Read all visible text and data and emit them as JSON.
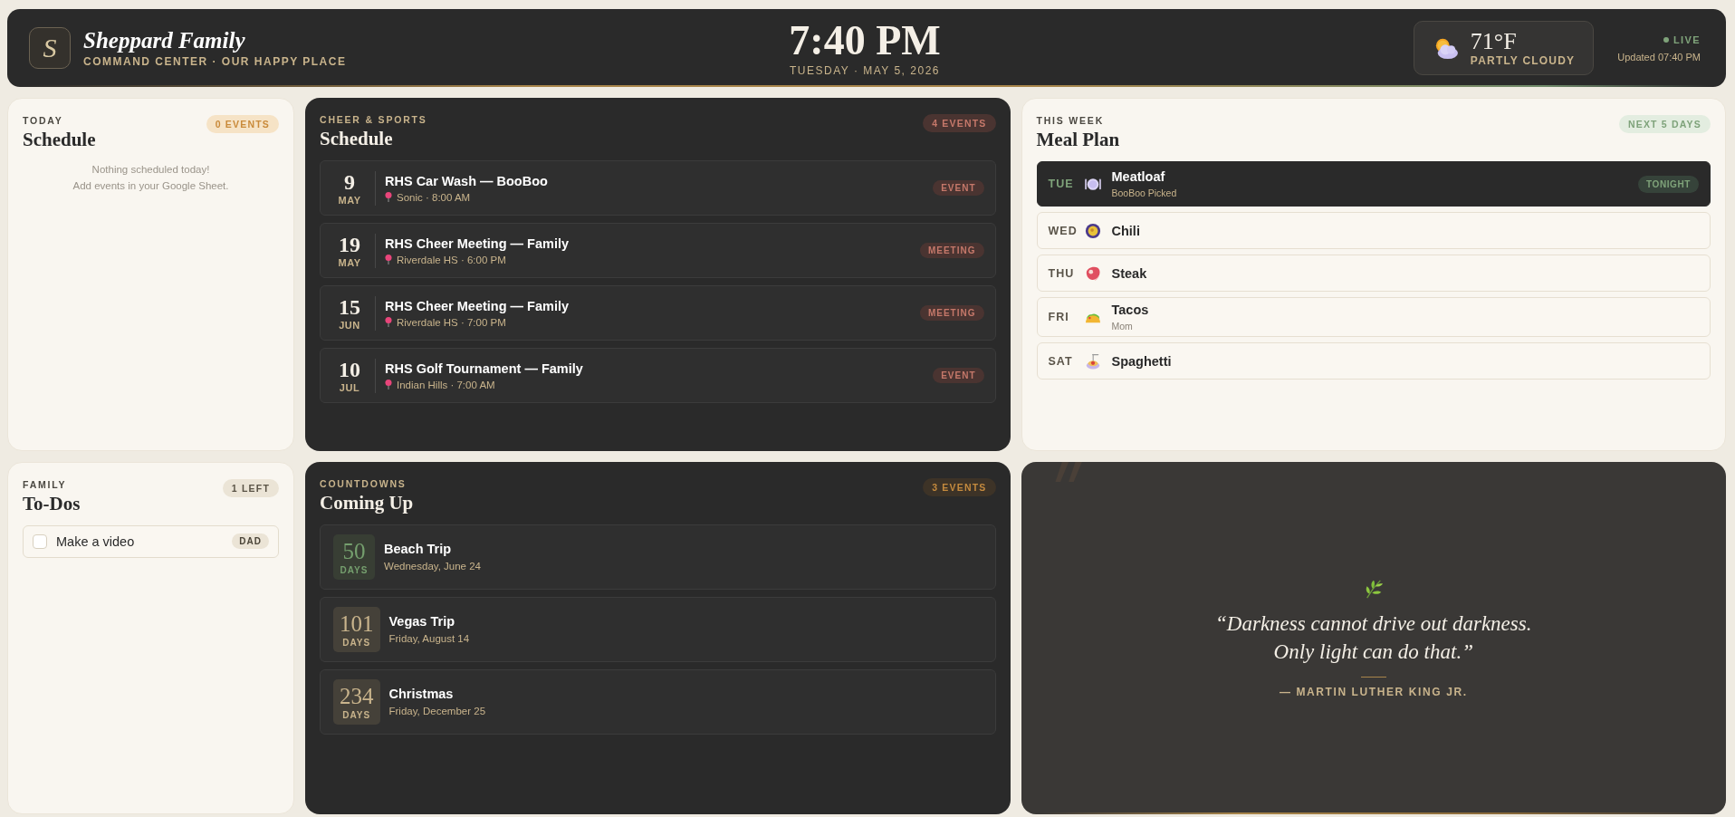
{
  "header": {
    "logo_letter": "S",
    "title": "Sheppard Family",
    "subtitle": "COMMAND CENTER · OUR HAPPY PLACE",
    "clock": "7:40 PM",
    "date": "TUESDAY · MAY 5, 2026",
    "weather": {
      "temp": "71°F",
      "condition": "PARTLY CLOUDY"
    },
    "live": "LIVE",
    "updated": "Updated 07:40 PM"
  },
  "today_schedule": {
    "eyebrow": "TODAY",
    "title": "Schedule",
    "badge": "0 EVENTS",
    "empty_lines": [
      "Nothing scheduled today!",
      "Add events in your Google Sheet."
    ]
  },
  "sports_schedule": {
    "eyebrow": "CHEER & SPORTS",
    "title": "Schedule",
    "badge": "4 EVENTS",
    "events": [
      {
        "day": "9",
        "month": "MAY",
        "title": "RHS Car Wash — BooBoo",
        "location": "Sonic · 8:00 AM",
        "tag": "EVENT"
      },
      {
        "day": "19",
        "month": "MAY",
        "title": "RHS Cheer Meeting — Family",
        "location": "Riverdale HS · 6:00 PM",
        "tag": "MEETING"
      },
      {
        "day": "15",
        "month": "JUN",
        "title": "RHS Cheer Meeting — Family",
        "location": "Riverdale HS · 7:00 PM",
        "tag": "MEETING"
      },
      {
        "day": "10",
        "month": "JUL",
        "title": "RHS Golf Tournament — Family",
        "location": "Indian Hills · 7:00 AM",
        "tag": "EVENT"
      }
    ]
  },
  "meal_plan": {
    "eyebrow": "THIS WEEK",
    "title": "Meal Plan",
    "badge": "NEXT 5 DAYS",
    "days": [
      {
        "day": "TUE",
        "kind": "plate",
        "meal": "Meatloaf",
        "note": "BooBoo Picked",
        "badge": "TONIGHT",
        "selected": true
      },
      {
        "day": "WED",
        "kind": "bowl",
        "meal": "Chili",
        "selected": false
      },
      {
        "day": "THU",
        "kind": "steak",
        "meal": "Steak",
        "selected": false
      },
      {
        "day": "FRI",
        "kind": "taco",
        "meal": "Tacos",
        "note": "Mom",
        "selected": false
      },
      {
        "day": "SAT",
        "kind": "pasta",
        "meal": "Spaghetti",
        "selected": false
      }
    ]
  },
  "todos": {
    "eyebrow": "FAMILY",
    "title": "To-Dos",
    "badge": "1 LEFT",
    "items": [
      {
        "text": "Make a video",
        "assignee": "DAD",
        "checked": false
      }
    ]
  },
  "countdowns": {
    "eyebrow": "COUNTDOWNS",
    "title": "Coming Up",
    "badge": "3 EVENTS",
    "items": [
      {
        "days": "50",
        "unit": "DAYS",
        "title": "Beach Trip",
        "date": "Wednesday, June 24",
        "color": "#759f6e"
      },
      {
        "days": "101",
        "unit": "DAYS",
        "title": "Vegas Trip",
        "date": "Friday, August 14",
        "color": "#c9b48c"
      },
      {
        "days": "234",
        "unit": "DAYS",
        "title": "Christmas",
        "date": "Friday, December 25",
        "color": "#c9b48c"
      }
    ]
  },
  "quote": {
    "lines": [
      "“Darkness cannot drive out darkness.",
      "Only light can do that.”"
    ],
    "author": "— MARTIN LUTHER KING JR."
  }
}
